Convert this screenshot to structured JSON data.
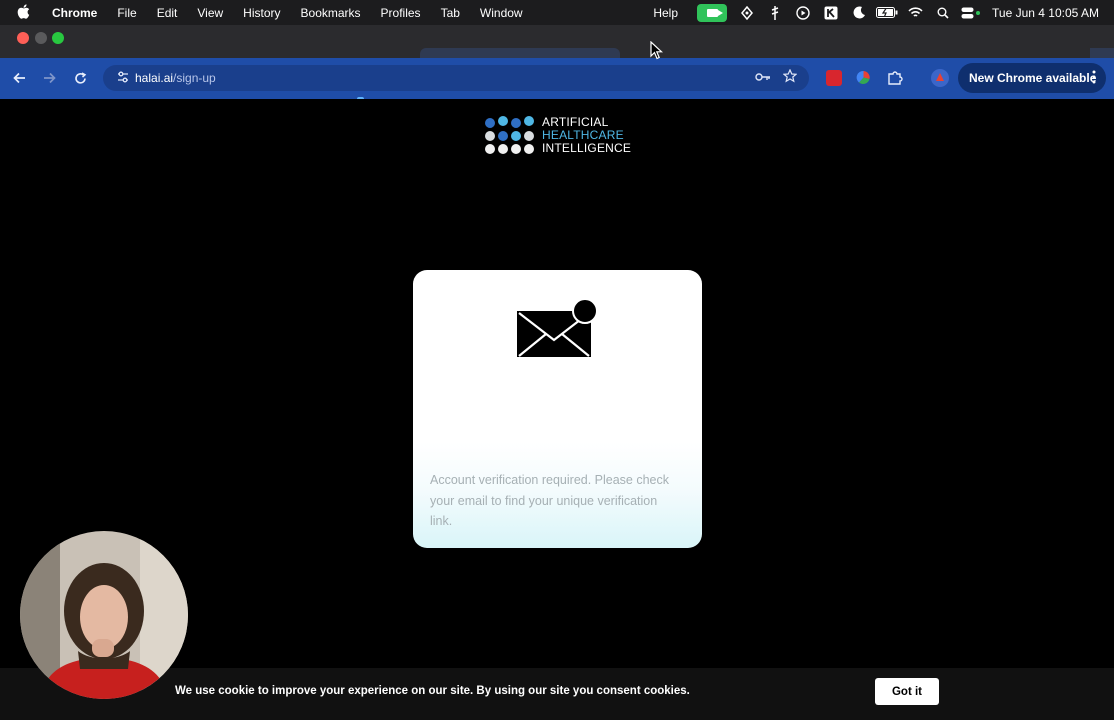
{
  "menubar": {
    "app_name": "Chrome",
    "menus": [
      "File",
      "Edit",
      "View",
      "History",
      "Bookmarks",
      "Profiles",
      "Tab",
      "Window",
      "Help"
    ],
    "datetime": "Tue Jun 4  10:05 AM"
  },
  "toolbar": {
    "url_host": "halai.ai",
    "url_path": "/sign-up",
    "update_label": "New Chrome available"
  },
  "logo": {
    "line1": "ARTIFICIAL",
    "line2": "HEALTHCARE",
    "line3": "INTELLIGENCE"
  },
  "card": {
    "message": "Account verification required. Please check your email to find your unique verification link."
  },
  "cookie": {
    "text": "We use cookie to improve your experience on our site. By using our site you consent cookies.",
    "button_label": "Got it"
  },
  "colors": {
    "toolbar": "#1f4da8",
    "logo_accent": "#4fb7e5",
    "logo_dot_dark": "#2f6fc4",
    "card_gradient_end": "#d9f5f8"
  }
}
